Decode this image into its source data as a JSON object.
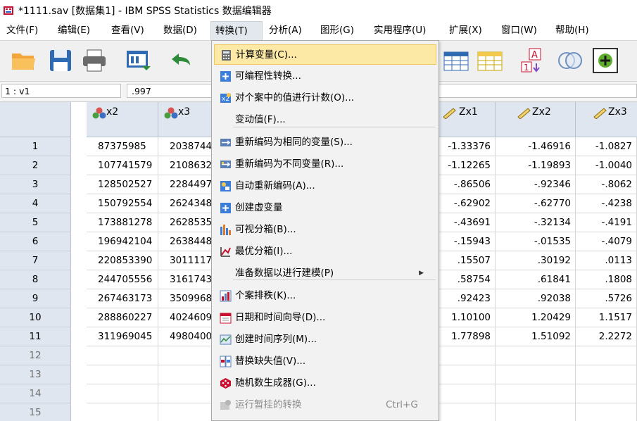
{
  "window": {
    "title": "*1111.sav [数据集1] - IBM SPSS Statistics 数据编辑器"
  },
  "menubar": [
    {
      "label": "文件(F)"
    },
    {
      "label": "编辑(E)"
    },
    {
      "label": "查看(V)"
    },
    {
      "label": "数据(D)"
    },
    {
      "label": "转换(T)"
    },
    {
      "label": "分析(A)"
    },
    {
      "label": "图形(G)"
    },
    {
      "label": "实用程序(U)"
    },
    {
      "label": "扩展(X)"
    },
    {
      "label": "窗口(W)"
    },
    {
      "label": "帮助(H)"
    }
  ],
  "cellbar": {
    "ref": "1 : v1",
    "value": ".997"
  },
  "grid": {
    "columns": [
      {
        "name": "x2",
        "icon": "nominal-measure-icon"
      },
      {
        "name": "x3",
        "icon": "nominal-measure-icon"
      },
      {
        "name": "Zx1",
        "icon": "scale-ruler-icon"
      },
      {
        "name": "Zx2",
        "icon": "scale-ruler-icon"
      },
      {
        "name": "Zx3",
        "icon": "scale-ruler-icon"
      }
    ],
    "rows": [
      {
        "n": "1",
        "x2": "87375985",
        "x3": "2038744",
        "zx1": "-1.33376",
        "zx2": "-1.46916",
        "zx3": "-1.0827"
      },
      {
        "n": "2",
        "x2": "107741579",
        "x3": "2108632",
        "zx1": "-1.12265",
        "zx2": "-1.19893",
        "zx3": "-1.0040"
      },
      {
        "n": "3",
        "x2": "128502527",
        "x3": "2284497",
        "zx1": "-.86506",
        "zx2": "-.92346",
        "zx3": "-.8062"
      },
      {
        "n": "4",
        "x2": "150792554",
        "x3": "2624348",
        "zx1": "-.62902",
        "zx2": "-.62770",
        "zx3": "-.4238"
      },
      {
        "n": "5",
        "x2": "173881278",
        "x3": "2628535",
        "zx1": "-.43691",
        "zx2": "-.32134",
        "zx3": "-.4191"
      },
      {
        "n": "6",
        "x2": "196942104",
        "x3": "2638448",
        "zx1": "-.15943",
        "zx2": "-.01535",
        "zx3": "-.4079"
      },
      {
        "n": "7",
        "x2": "220853390",
        "x3": "3011117",
        "zx1": ".15507",
        "zx2": ".30192",
        "zx3": ".0113"
      },
      {
        "n": "8",
        "x2": "244705556",
        "x3": "3161743",
        "zx1": ".58754",
        "zx2": ".61841",
        "zx3": ".1808"
      },
      {
        "n": "9",
        "x2": "267463173",
        "x3": "3509968",
        "zx1": ".92423",
        "zx2": ".92038",
        "zx3": ".5726"
      },
      {
        "n": "10",
        "x2": "288860227",
        "x3": "4024609",
        "zx1": "1.10100",
        "zx2": "1.20429",
        "zx3": "1.1517"
      },
      {
        "n": "11",
        "x2": "311969045",
        "x3": "4980400",
        "zx1": "1.77898",
        "zx2": "1.51092",
        "zx3": "2.2272"
      }
    ],
    "empty_rows": [
      "12",
      "13",
      "14",
      "15"
    ]
  },
  "transform_menu": {
    "items": [
      {
        "label": "计算变量(C)...",
        "icon": "calculator-icon",
        "highlighted": true
      },
      {
        "label": "可编程性转换...",
        "icon": "plus-box-icon"
      },
      {
        "label": "对个案中的值进行计数(O)...",
        "icon": "count-values-icon"
      },
      {
        "label": "变动值(F)...",
        "icon": ""
      },
      {
        "label": "重新编码为相同的变量(S)...",
        "icon": "recode-same-icon"
      },
      {
        "label": "重新编码为不同变量(R)...",
        "icon": "recode-different-icon"
      },
      {
        "label": "自动重新编码(A)...",
        "icon": "auto-recode-icon"
      },
      {
        "label": "创建虚变量",
        "icon": "plus-box-icon"
      },
      {
        "label": "可视分箱(B)...",
        "icon": "visual-binning-icon"
      },
      {
        "label": "最优分箱(I)...",
        "icon": "optimal-binning-icon"
      },
      {
        "label": "准备数据以进行建模(P)",
        "icon": "",
        "submenu": true
      },
      {
        "label": "个案排秩(K)...",
        "icon": "rank-cases-icon"
      },
      {
        "label": "日期和时间向导(D)...",
        "icon": "calendar-icon"
      },
      {
        "label": "创建时间序列(M)...",
        "icon": "time-series-icon"
      },
      {
        "label": "替换缺失值(V)...",
        "icon": "replace-missing-icon"
      },
      {
        "label": "随机数生成器(G)...",
        "icon": "dice-icon"
      },
      {
        "label": "运行暂挂的转换",
        "icon": "pending-transform-icon",
        "shortcut": "Ctrl+G",
        "disabled": true
      }
    ]
  }
}
